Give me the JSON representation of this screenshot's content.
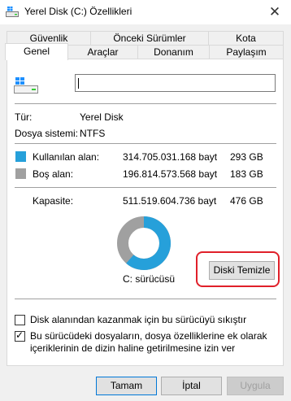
{
  "window": {
    "title": "Yerel Disk (C:) Özellikleri",
    "close_glyph": "✕"
  },
  "tabs_row1": [
    "Güvenlik",
    "Önceki Sürümler",
    "Kota"
  ],
  "tabs_row2": [
    "Genel",
    "Araçlar",
    "Donanım",
    "Paylaşım"
  ],
  "active_tab": "Genel",
  "general": {
    "drive_name_value": "",
    "type_label": "Tür:",
    "type_value": "Yerel Disk",
    "fs_label": "Dosya sistemi:",
    "fs_value": "NTFS",
    "used_label": "Kullanılan alan:",
    "used_bytes": "314.705.031.168 bayt",
    "used_gb": "293 GB",
    "free_label": "Boş alan:",
    "free_bytes": "196.814.573.568 bayt",
    "free_gb": "183 GB",
    "capacity_label": "Kapasite:",
    "capacity_bytes": "511.519.604.736 bayt",
    "capacity_gb": "476 GB",
    "drive_caption": "C: sürücüsü",
    "cleanup_button": "Diski Temizle",
    "compress_label": "Disk alanından kazanmak için bu sürücüyü sıkıştır",
    "compress_checked": false,
    "index_label_line1": "Bu sürücüdeki dosyaların, dosya özelliklerine ek olarak",
    "index_label_line2": "içeriklerinin de dizin haline getirilmesine izin ver",
    "index_checked": true,
    "used_fraction": 0.615
  },
  "colors": {
    "used": "#26a0da",
    "free": "#a0a0a0",
    "highlight": "#e0202a"
  },
  "buttons": {
    "ok": "Tamam",
    "cancel": "İptal",
    "apply": "Uygula"
  }
}
